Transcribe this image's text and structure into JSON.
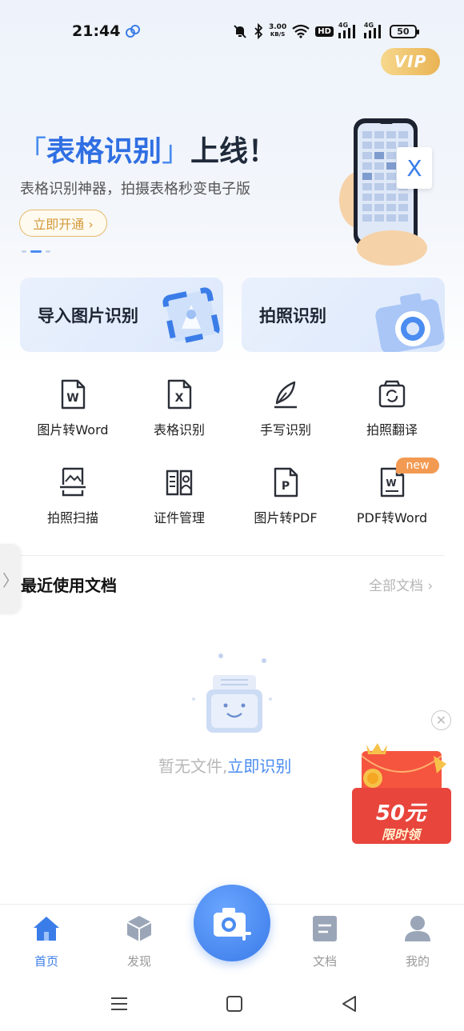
{
  "status_bar": {
    "time": "21:44",
    "speed_value": "3.00",
    "speed_unit": "KB/S",
    "hd_label": "HD",
    "signal_1": "4G",
    "signal_2": "4G",
    "battery": "50"
  },
  "vip": {
    "label": "VIP"
  },
  "banner": {
    "bracket_open": "「",
    "highlight": "表格识别",
    "bracket_close": "」",
    "title_rest": "上线！",
    "subtitle": "表格识别神器，拍摄表格秒变电子版",
    "button_label": "立即开通 ›",
    "phone_badge": "X"
  },
  "main_cards": [
    {
      "label": "导入图片识别"
    },
    {
      "label": "拍照识别"
    }
  ],
  "tools": [
    {
      "label": "图片转Word",
      "icon": "word-doc-icon",
      "glyph": "W"
    },
    {
      "label": "表格识别",
      "icon": "excel-doc-icon",
      "glyph": "X"
    },
    {
      "label": "手写识别",
      "icon": "quill-icon"
    },
    {
      "label": "拍照翻译",
      "icon": "camera-translate-icon"
    },
    {
      "label": "拍照扫描",
      "icon": "scan-image-icon"
    },
    {
      "label": "证件管理",
      "icon": "id-card-book-icon"
    },
    {
      "label": "图片转PDF",
      "icon": "pdf-doc-icon",
      "glyph": "P"
    },
    {
      "label": "PDF转Word",
      "icon": "pdf-to-word-icon",
      "glyph": "W"
    }
  ],
  "new_badge": "new",
  "recent": {
    "title": "最近使用文档",
    "all_label": "全部文档 ›",
    "side_tab": "〉"
  },
  "empty_state": {
    "text": "暂无文件,",
    "link": "立即识别"
  },
  "promo": {
    "close": "✕",
    "amount": "50元",
    "subtitle": "限时领"
  },
  "bottom_nav": [
    {
      "label": "首页",
      "icon": "home-icon",
      "active": true
    },
    {
      "label": "发现",
      "icon": "discover-cube-icon",
      "active": false
    },
    {
      "label": "文档",
      "icon": "document-icon",
      "active": false
    },
    {
      "label": "我的",
      "icon": "profile-icon",
      "active": false
    }
  ],
  "colors": {
    "primary": "#3b7de8",
    "accent_gold": "#e5b969",
    "new_badge": "#f39a52",
    "promo_red": "#e8453c"
  }
}
